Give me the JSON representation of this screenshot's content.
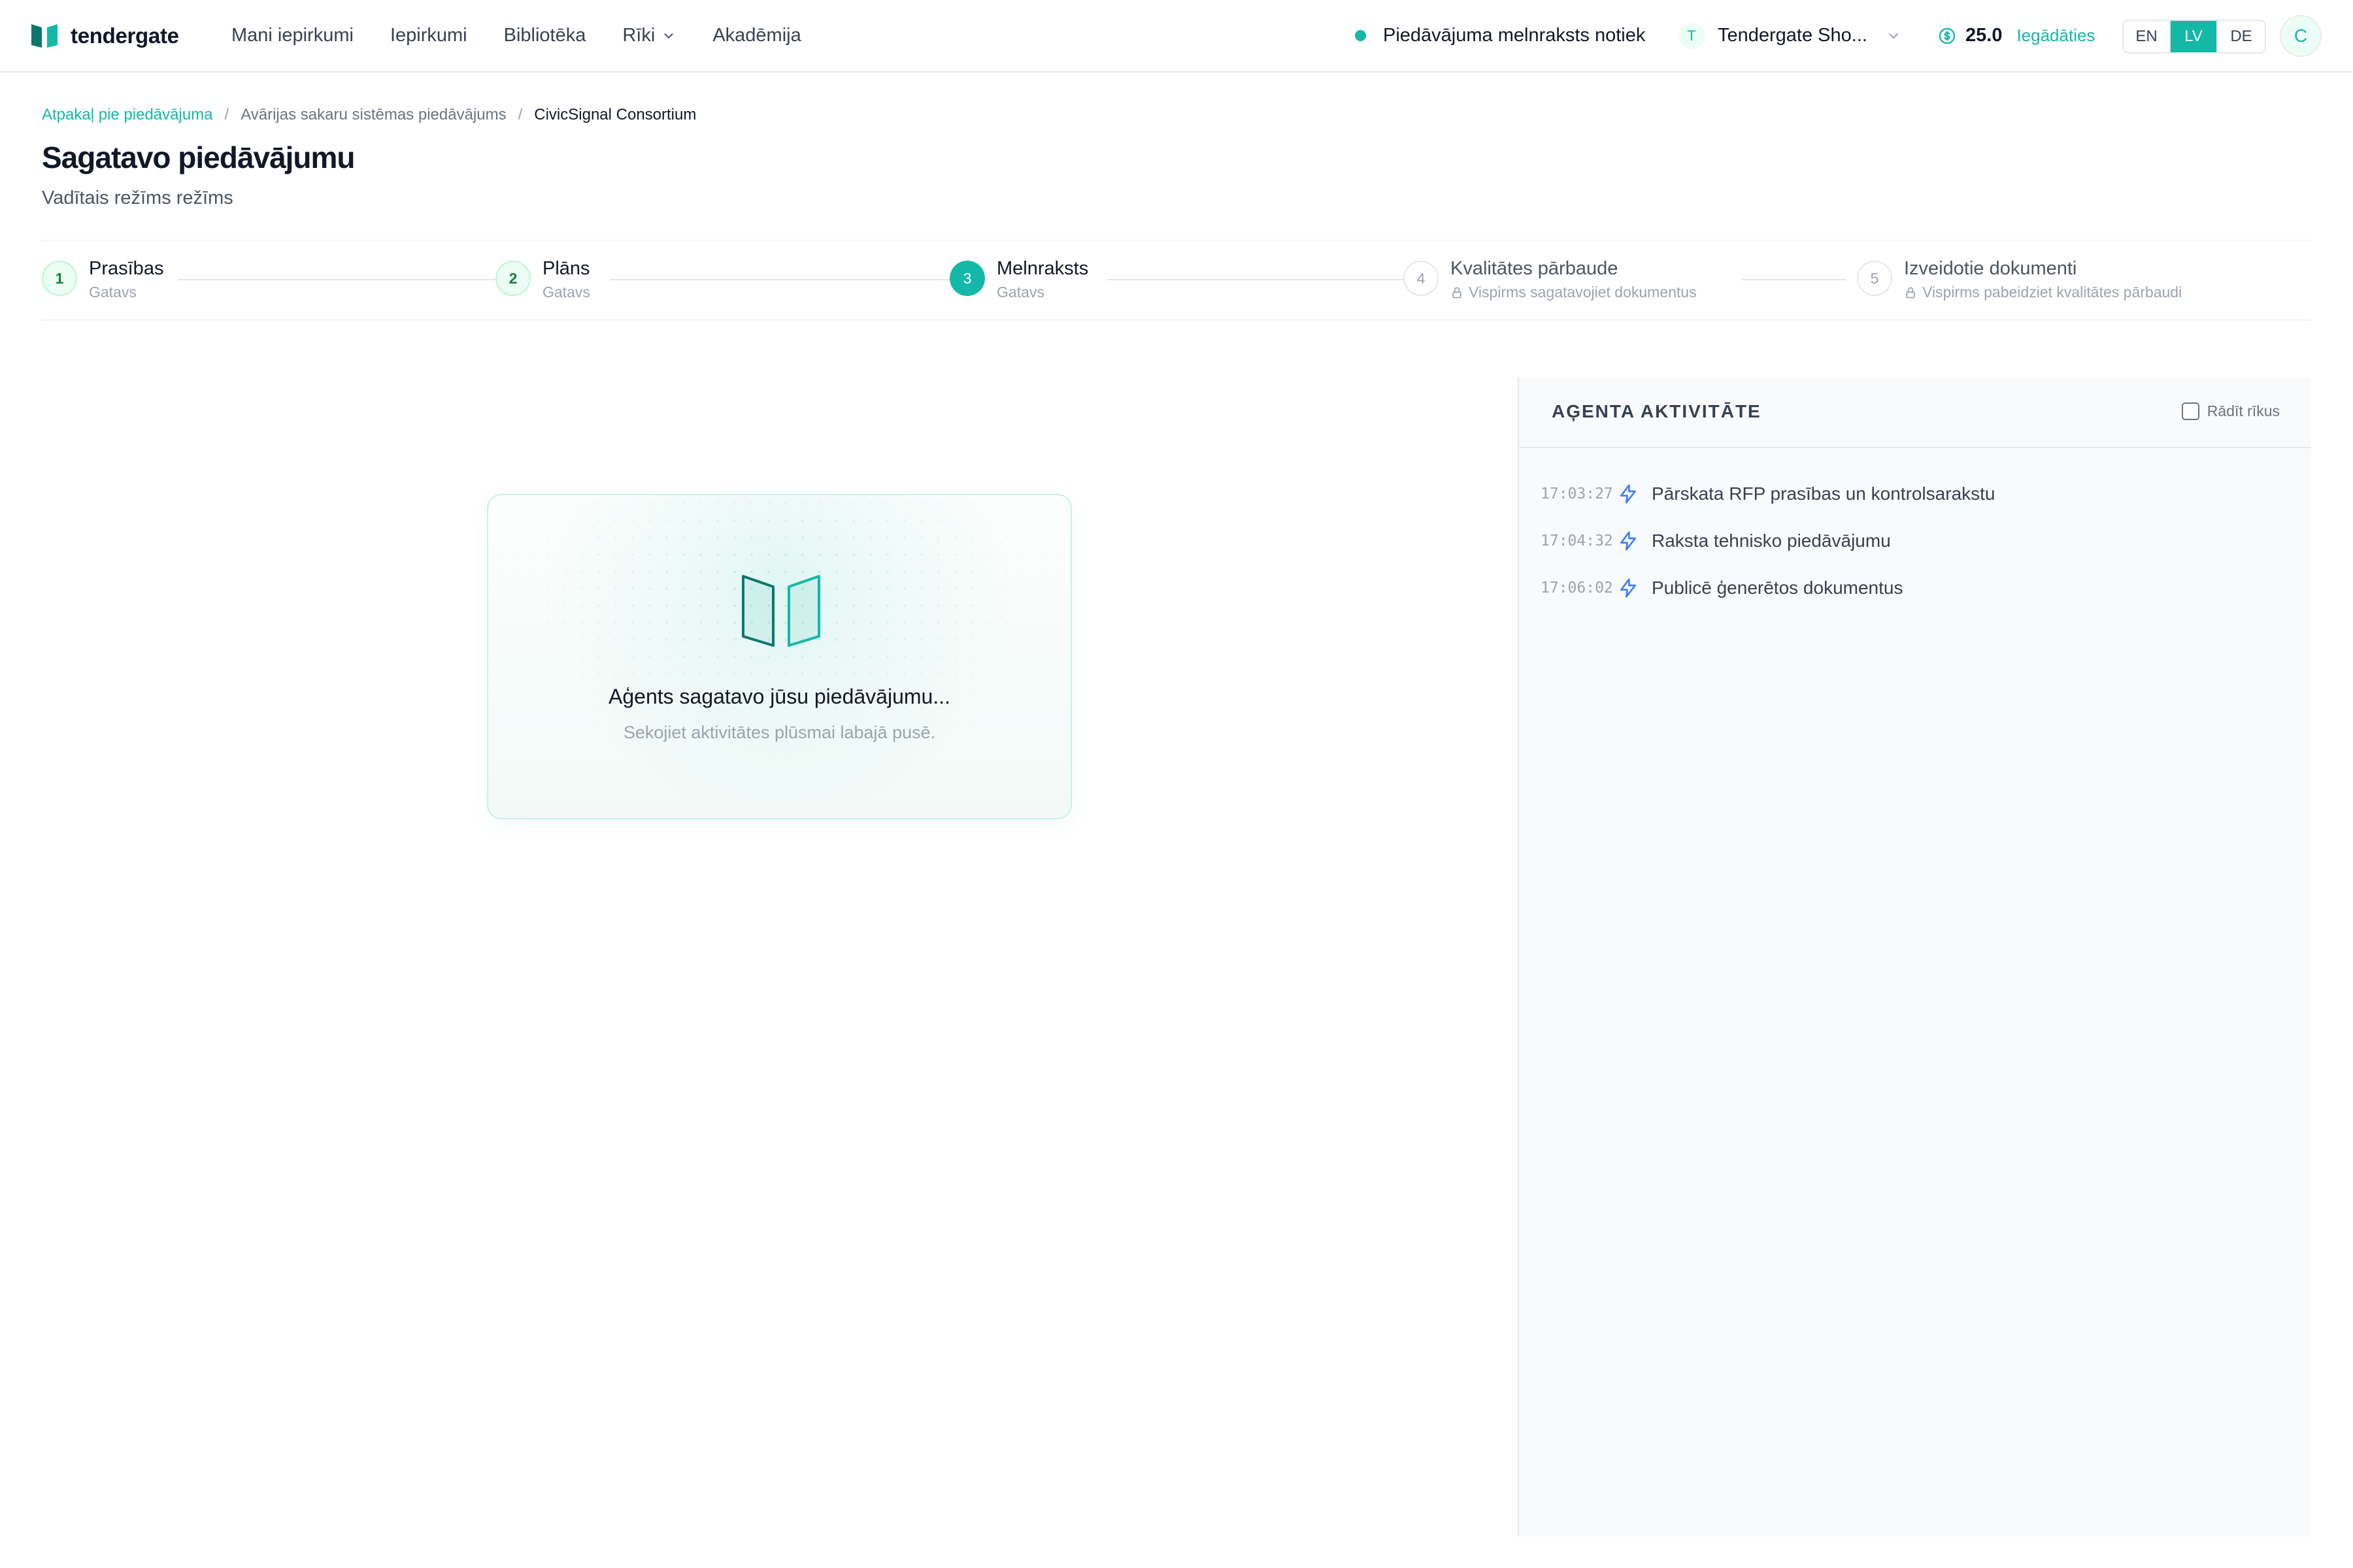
{
  "app": {
    "name": "tendergate"
  },
  "nav": {
    "items": [
      {
        "label": "Mani iepirkumi"
      },
      {
        "label": "Iepirkumi"
      },
      {
        "label": "Bibliotēka"
      },
      {
        "label": "Rīki"
      },
      {
        "label": "Akadēmija"
      }
    ]
  },
  "status": {
    "text": "Piedāvājuma melnraksts notiek"
  },
  "org": {
    "initial": "T",
    "name": "Tendergate Sho..."
  },
  "credits": {
    "value": "25.0",
    "link_label": "Iegādāties"
  },
  "languages": [
    {
      "code": "EN",
      "active": false
    },
    {
      "code": "LV",
      "active": true
    },
    {
      "code": "DE",
      "active": false
    }
  ],
  "user": {
    "initial": "C"
  },
  "breadcrumb": {
    "back": "Atpakaļ pie piedāvājuma",
    "parent": "Avārijas sakaru sistēmas piedāvājums",
    "current": "CivicSignal Consortium"
  },
  "page": {
    "title": "Sagatavo piedāvājumu",
    "subtitle": "Vadītais režīms režīms"
  },
  "steps": [
    {
      "number": "1",
      "title": "Prasības",
      "status": "Gatavs",
      "state": "done"
    },
    {
      "number": "2",
      "title": "Plāns",
      "status": "Gatavs",
      "state": "done"
    },
    {
      "number": "3",
      "title": "Melnraksts",
      "status": "Gatavs",
      "state": "active"
    },
    {
      "number": "4",
      "title": "Kvalitātes pārbaude",
      "status": "Vispirms sagatavojiet dokumentus",
      "state": "locked"
    },
    {
      "number": "5",
      "title": "Izveidotie dokumenti",
      "status": "Vispirms pabeidziet kvalitātes pārbaudi",
      "state": "locked"
    }
  ],
  "agent_card": {
    "title": "Aģents sagatavo jūsu piedāvājumu...",
    "subtitle": "Sekojiet aktivitātes plūsmai labajā pusē."
  },
  "activity": {
    "title": "AĢENTA AKTIVITĀTE",
    "show_tools_label": "Rādīt rīkus",
    "show_tools_checked": false,
    "items": [
      {
        "time": "17:03:27",
        "icon": "lightning-icon",
        "text": "Pārskata RFP prasības un kontrolsarakstu"
      },
      {
        "time": "17:04:32",
        "icon": "lightning-icon",
        "text": "Raksta tehnisko piedāvājumu"
      },
      {
        "time": "17:06:02",
        "icon": "lightning-icon",
        "text": "Publicē ģenerētos dokumentus"
      }
    ]
  },
  "colors": {
    "accent": "#14b8a6",
    "accent_dark": "#0f766e",
    "text": "#111827",
    "muted": "#9ca3af",
    "lightning": "#3b82f6"
  }
}
